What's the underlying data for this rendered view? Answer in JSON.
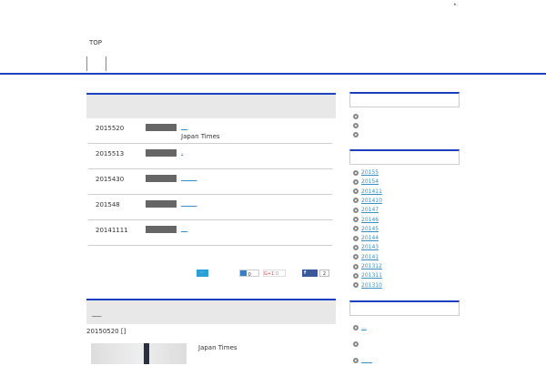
{
  "header": {
    "top_marker": "▸.",
    "nav_top": "TOP"
  },
  "news": {
    "rows": [
      {
        "date": "2015520",
        "link": "__",
        "sub": "Japan Times"
      },
      {
        "date": "2015513",
        "link": ".",
        "sub": ""
      },
      {
        "date": "2015430",
        "link": "_____",
        "sub": ""
      },
      {
        "date": "201548",
        "link": "_____",
        "sub": ""
      },
      {
        "date": "20141111",
        "link": "__",
        "sub": ""
      }
    ]
  },
  "social": {
    "hatena_count": "0",
    "gplus_label": "G+1",
    "gplus_count": "0",
    "facebook_count": "2"
  },
  "post": {
    "title": "___",
    "meta": "20150520 []",
    "excerpt": "Japan Times"
  },
  "sidebar": {
    "archives": [
      "20155",
      "20154",
      "201411",
      "201410",
      "20147",
      "20146",
      "20145",
      "20144",
      "20143",
      "20141",
      "201312",
      "201311",
      "201310"
    ],
    "recent": [
      "...",
      "",
      "____"
    ]
  }
}
